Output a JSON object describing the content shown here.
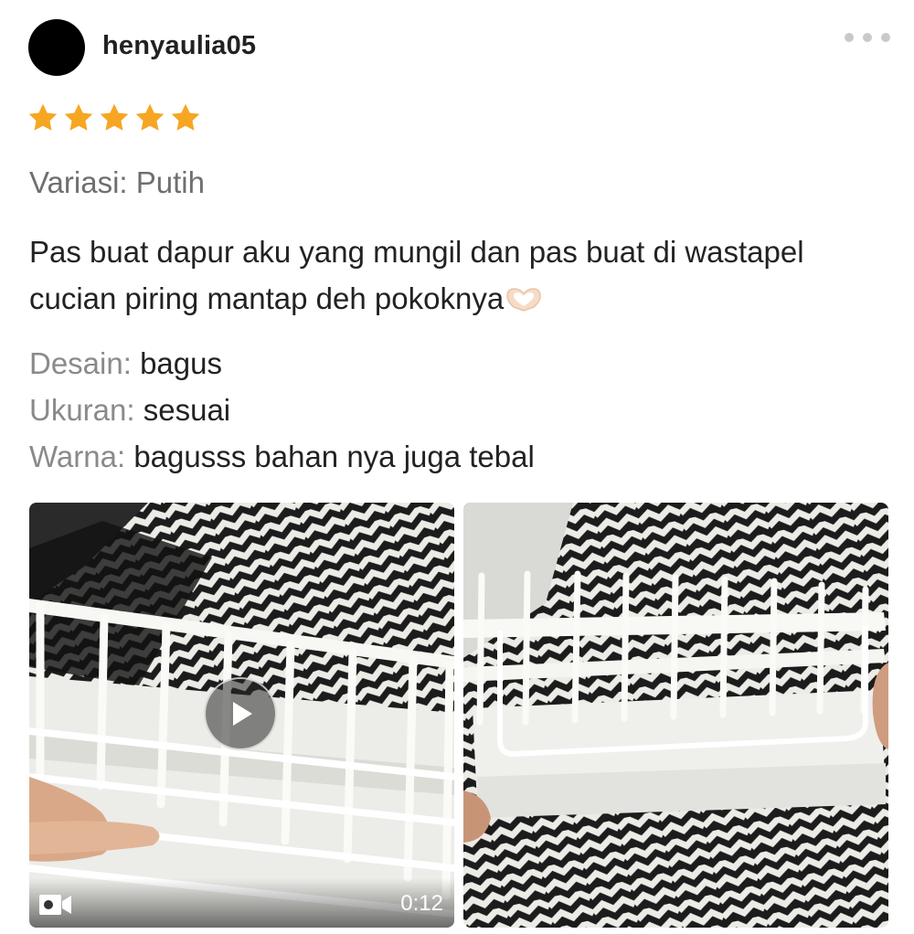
{
  "review": {
    "username": "henyaulia05",
    "rating": 5,
    "rating_max": 5,
    "variation": "Variasi: Putih",
    "text": "Pas buat dapur aku yang mungil dan pas buat di wastapel cucian piring mantap deh pokoknya",
    "text_emoji": "heart-hands-icon",
    "attributes": [
      {
        "key": "Desain:",
        "value": "bagus"
      },
      {
        "key": "Ukuran:",
        "value": "sesuai"
      },
      {
        "key": "Warna:",
        "value": "bagusss bahan nya juga tebal"
      }
    ]
  },
  "media": [
    {
      "type": "video",
      "duration": "0:12",
      "icon": "video-camera-icon",
      "play_icon": "play-icon"
    },
    {
      "type": "photo"
    }
  ],
  "colors": {
    "star": "#f6a623",
    "avatar": "#000000",
    "label_gray": "#8a8a8a",
    "text": "#222222"
  }
}
